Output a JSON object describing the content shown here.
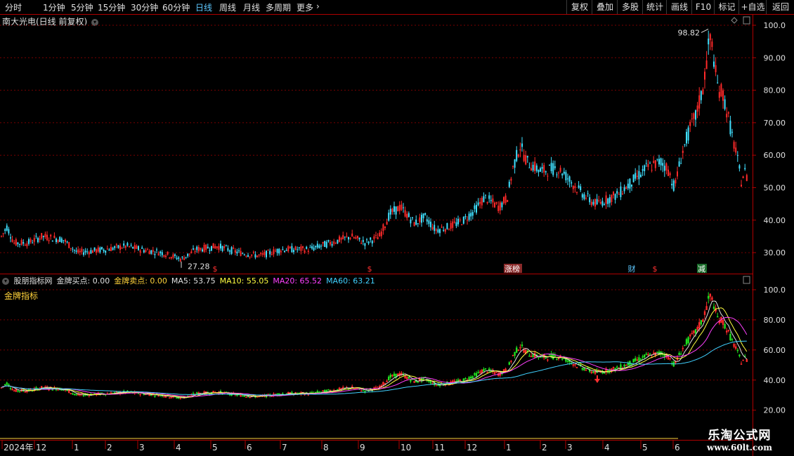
{
  "toolbar": {
    "periods": [
      "分时",
      "1分钟",
      "5分钟",
      "15分钟",
      "30分钟",
      "60分钟",
      "日线",
      "周线",
      "月线",
      "多周期",
      "更多"
    ],
    "active_period": "日线",
    "buttons": [
      "复权",
      "叠加",
      "多股",
      "统计",
      "画线",
      "F10",
      "标记",
      "+自选",
      "返回"
    ]
  },
  "upper": {
    "title": "南大光电(日线 前复权)",
    "price_axis": [
      "100.0",
      "90.00",
      "80.00",
      "70.00",
      "60.00",
      "50.00",
      "40.00",
      "30.00"
    ],
    "high_label": "98.82",
    "low_label": "27.28",
    "events": [
      {
        "label": "$",
        "color": "#ff3030",
        "type": "dollar"
      },
      {
        "label": "$",
        "color": "#ff3030",
        "type": "dollar"
      },
      {
        "label": "涨榜",
        "color": "#ffffff",
        "bg": "#8a2a2a"
      },
      {
        "label": "财",
        "color": "#5ec8ff"
      },
      {
        "label": "$",
        "color": "#ff3030",
        "type": "dollar"
      },
      {
        "label": "减",
        "color": "#ffffff",
        "bg": "#1a6a2a"
      }
    ]
  },
  "lower": {
    "legend": [
      {
        "text": "股朋指标网",
        "color": "#e0e0e0"
      },
      {
        "text": "金牌买点: 0.00",
        "color": "#e0e0e0"
      },
      {
        "text": "金牌卖点: 0.00",
        "color": "#ffd23a"
      },
      {
        "text": "MA5: 53.75",
        "color": "#e0e0e0"
      },
      {
        "text": "MA10: 55.05",
        "color": "#ffff40"
      },
      {
        "text": "MA20: 65.52",
        "color": "#ff40ff"
      },
      {
        "text": "MA60: 63.21",
        "color": "#40d0ff"
      }
    ],
    "indicator_name": "金牌指标",
    "axis": [
      "100.0",
      "80.00",
      "60.00",
      "40.00",
      "20.00"
    ]
  },
  "date_axis": [
    "2024年",
    "12",
    "1",
    "2",
    "3",
    "4",
    "5",
    "6",
    "7",
    "8",
    "9",
    "10",
    "11",
    "12",
    "1",
    "2",
    "3",
    "4",
    "5",
    "6"
  ],
  "watermark": {
    "line1": "乐淘公式网",
    "line2": "www.60lt.com"
  },
  "colors": {
    "up": "#ff2a2a",
    "down": "#40e0ff",
    "down_lower": "#20e020",
    "grid": "#7a0000",
    "border": "#b00000"
  }
}
